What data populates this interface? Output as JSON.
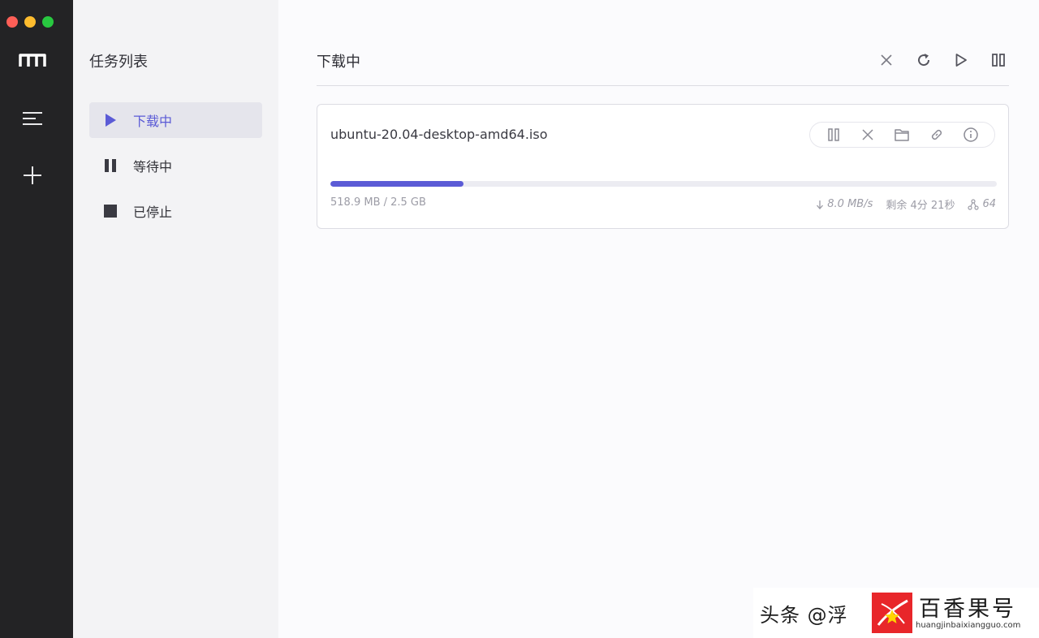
{
  "window": {
    "traffic_lights": [
      "#fe5f57",
      "#febc2e",
      "#28c840"
    ]
  },
  "rail": {
    "logo_icon": "motrix-m-logo",
    "menu_icon": "hamburger-icon",
    "add_icon": "plus-icon"
  },
  "sidebar": {
    "title": "任务列表",
    "items": [
      {
        "label": "下载中",
        "icon": "play-icon",
        "active": true
      },
      {
        "label": "等待中",
        "icon": "pause-icon",
        "active": false
      },
      {
        "label": "已停止",
        "icon": "stop-icon",
        "active": false
      }
    ]
  },
  "main": {
    "title": "下载中",
    "toolbar": [
      "close-icon",
      "refresh-icon",
      "play-icon",
      "pause-icon"
    ]
  },
  "task": {
    "name": "ubuntu-20.04-desktop-amd64.iso",
    "size": "518.9 MB / 2.5 GB",
    "speed": "8.0 MB/s",
    "remaining": "剩余 4分 21秒",
    "connections": "64",
    "progress": 0.2,
    "actions": [
      "pause-icon",
      "delete-icon",
      "folder-icon",
      "link-icon",
      "info-icon"
    ]
  },
  "colors": {
    "accent": "#5b5bd6",
    "rail": "#232325",
    "sidebar": "#f3f3f5",
    "main": "#fbfbfd"
  },
  "watermark": {
    "handle": "头条 @浮",
    "brand": "百香果号",
    "url": "huangjinbaixiangguo.com"
  }
}
